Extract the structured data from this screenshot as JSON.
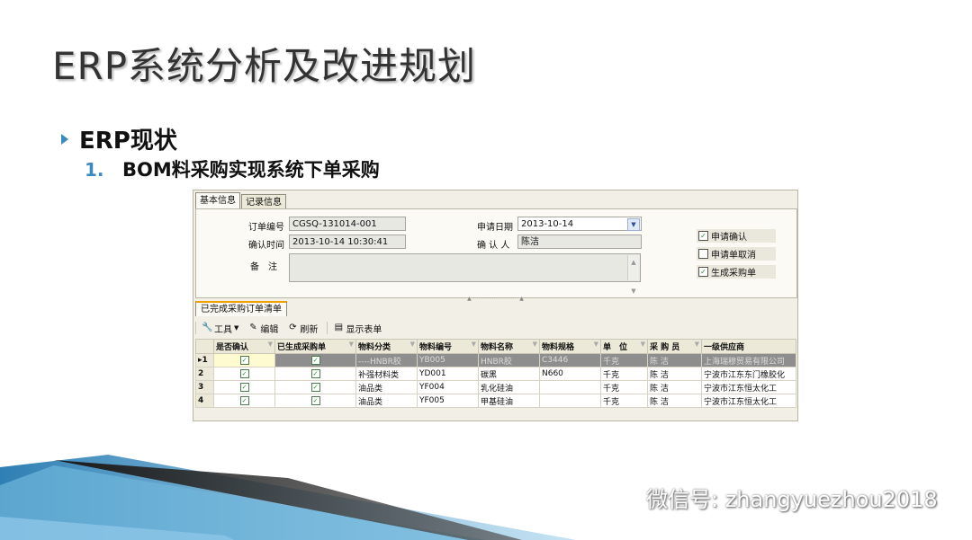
{
  "slide": {
    "title": "ERP系统分析及改进规划",
    "bullet1": "ERP现状",
    "bullet2_num": "1.",
    "bullet2_text": "BOM料采购实现系统下单采购"
  },
  "erp": {
    "tabs": [
      "基本信息",
      "记录信息"
    ],
    "form": {
      "order_no_label": "订单编号",
      "order_no": "CGSQ-131014-001",
      "confirm_time_label": "确认时间",
      "confirm_time": "2013-10-14 10:30:41",
      "remark_label": "备　注",
      "remark": "",
      "apply_date_label": "申请日期",
      "apply_date": "2013-10-14",
      "confirmer_label": "确 认 人",
      "confirmer": "陈洁",
      "checks": [
        {
          "label": "申请确认",
          "checked": true
        },
        {
          "label": "申请单取消",
          "checked": false
        },
        {
          "label": "生成采购单",
          "checked": true
        }
      ]
    },
    "sub_tab": "已完成采购订单清单",
    "toolbar": {
      "tools": "工具",
      "edit": "编辑",
      "refresh": "刷新",
      "show_form": "显示表单"
    },
    "grid": {
      "columns": [
        "是否确认",
        "已生成采购单",
        "物料分类",
        "物料编号",
        "物料名称",
        "物料规格",
        "单　位",
        "采 购 员",
        "一级供应商"
      ],
      "rows": [
        {
          "idx": "▸1",
          "confirmed": true,
          "generated": true,
          "category": "----HNBR胶",
          "code": "YB005",
          "name": "HNBR胶",
          "spec": "C3446",
          "unit": "千克",
          "buyer": "陈 洁",
          "supplier": "上海瑞穆贸易有限公司"
        },
        {
          "idx": "2",
          "confirmed": true,
          "generated": true,
          "category": "补强材料类",
          "code": "YD001",
          "name": "碳黑",
          "spec": "N660",
          "unit": "千克",
          "buyer": "陈 洁",
          "supplier": "宁波市江东东门橡胶化"
        },
        {
          "idx": "3",
          "confirmed": true,
          "generated": true,
          "category": "油品类",
          "code": "YF004",
          "name": "乳化硅油",
          "spec": "",
          "unit": "千克",
          "buyer": "陈 洁",
          "supplier": "宁波市江东恒太化工"
        },
        {
          "idx": "4",
          "confirmed": true,
          "generated": true,
          "category": "油品类",
          "code": "YF005",
          "name": "甲基硅油",
          "spec": "",
          "unit": "千克",
          "buyer": "陈 洁",
          "supplier": "宁波市江东恒太化工"
        }
      ]
    }
  },
  "watermark": "微信号: zhangyuezhou2018",
  "colors": {
    "accent": "#3a8bbf",
    "stripe_dark": "#1c1c1c",
    "stripe_blue": "#4aa0d0"
  }
}
